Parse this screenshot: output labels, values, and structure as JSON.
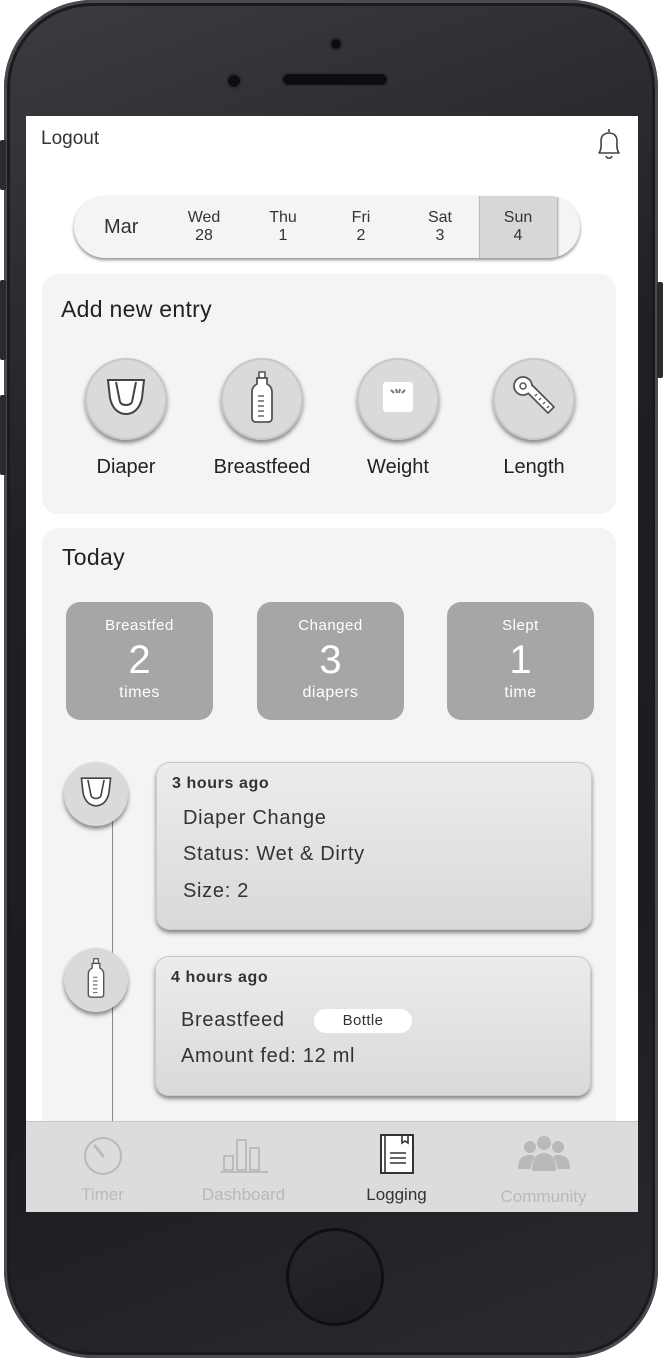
{
  "header": {
    "logout_label": "Logout",
    "bell_icon": "bell-icon"
  },
  "datebar": {
    "month": "Mar",
    "days": [
      {
        "name": "Wed",
        "num": "28"
      },
      {
        "name": "Thu",
        "num": "1"
      },
      {
        "name": "Fri",
        "num": "2"
      },
      {
        "name": "Sat",
        "num": "3"
      },
      {
        "name": "Sun",
        "num": "4"
      }
    ],
    "selected_index": 4
  },
  "add_entry": {
    "title": "Add new entry",
    "items": [
      {
        "label": "Diaper",
        "icon": "diaper-icon"
      },
      {
        "label": "Breastfeed",
        "icon": "bottle-icon"
      },
      {
        "label": "Weight",
        "icon": "scale-icon"
      },
      {
        "label": "Length",
        "icon": "tape-measure-icon"
      }
    ]
  },
  "today": {
    "title": "Today",
    "stats": [
      {
        "label": "Breastfed",
        "value": "2",
        "unit": "times"
      },
      {
        "label": "Changed",
        "value": "3",
        "unit": "diapers"
      },
      {
        "label": "Slept",
        "value": "1",
        "unit": "time"
      }
    ],
    "log": [
      {
        "ago": "3 hours ago",
        "title": "Diaper Change",
        "status": "Status: Wet & Dirty",
        "size": "Size: 2",
        "icon": "diaper-icon"
      },
      {
        "ago": "4 hours ago",
        "title": "Breastfeed",
        "badge": "Bottle",
        "amount": "Amount fed: 12 ml",
        "icon": "bottle-icon"
      }
    ]
  },
  "tabs": [
    {
      "label": "Timer",
      "icon": "timer-icon"
    },
    {
      "label": "Dashboard",
      "icon": "chart-icon"
    },
    {
      "label": "Logging",
      "icon": "notebook-icon"
    },
    {
      "label": "Community",
      "icon": "people-icon"
    }
  ],
  "active_tab": "Logging",
  "colors": {
    "stat_bg": "#a6a6a6",
    "card_bg": "#f4f4f4",
    "tab_bg": "#dcdcdc",
    "device": "#1f2024"
  }
}
